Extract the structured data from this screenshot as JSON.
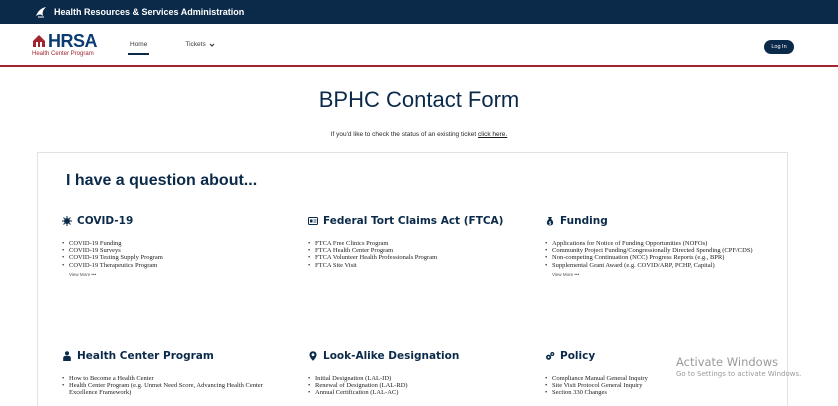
{
  "gov_bar": {
    "title": "Health Resources & Services Administration"
  },
  "logo": {
    "text": "HRSA",
    "subtitle": "Health Center Program"
  },
  "nav": [
    {
      "label": "Home",
      "active": true
    },
    {
      "label": "Tickets",
      "dropdown": true
    }
  ],
  "login_label": "Log In",
  "page": {
    "title": "BPHC Contact Form",
    "status_prefix": "If you'd like to check the status of an existing ticket ",
    "status_link": "click here."
  },
  "question_heading": "I have a question about...",
  "categories": [
    {
      "title": "COVID-19",
      "icon": "virus-icon",
      "items": [
        "COVID-19 Funding",
        "COVID-19 Surveys",
        "COVID-19 Testing Supply Program",
        "COVID-19 Therapeutics Program"
      ],
      "view_more": "View More •••"
    },
    {
      "title": "Federal Tort Claims Act (FTCA)",
      "icon": "id-card-icon",
      "items": [
        "FTCA Free Clinics Program",
        "FTCA Health Center Program",
        "FTCA Volunteer Health Professionals Program",
        "FTCA Site Visit"
      ],
      "view_more": ""
    },
    {
      "title": "Funding",
      "icon": "money-bag-icon",
      "items": [
        "Applications for Notice of Funding Opportunities (NOFOs)",
        "Community Project Funding/Congressionally Directed Spending (CPF/CDS)",
        "Non-competing Continuation (NCC) Progress Reports (e.g., BPR)",
        "Supplemental Grant Award (e.g. COVID/ARP, PCHP, Capital)"
      ],
      "view_more": "View More •••"
    },
    {
      "title": "Health Center Program",
      "icon": "person-icon",
      "items": [
        "How to Become a Health Center",
        "Health Center Program (e.g. Unmet Need Score, Advancing Health Center Excellence Framework)"
      ],
      "view_more": ""
    },
    {
      "title": "Look-Alike Designation",
      "icon": "map-pin-icon",
      "items": [
        "Initial Designation (LAL-ID)",
        "Renewal of Designation (LAL-RD)",
        "Annual Certification (LAL-AC)"
      ],
      "view_more": ""
    },
    {
      "title": "Policy",
      "icon": "gears-icon",
      "items": [
        "Compliance Manual General Inquiry",
        "Site Visit Protocol General Inquiry",
        "Section 330 Changes"
      ],
      "view_more": ""
    }
  ],
  "watermark": {
    "title": "Activate Windows",
    "subtitle": "Go to Settings to activate Windows."
  },
  "colors": {
    "navy": "#0b2a4a",
    "accent_red": "#a2242f",
    "logo_blue": "#0b3b72"
  }
}
